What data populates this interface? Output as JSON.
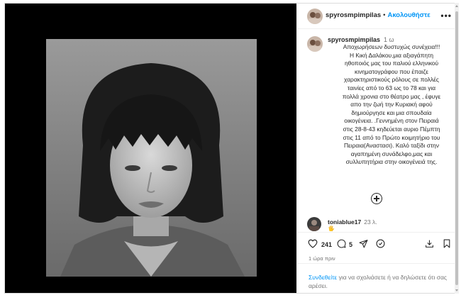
{
  "header": {
    "username": "spyrosmpimpilas",
    "separator": "•",
    "follow_label": "Ακολουθήστε",
    "more_icon": "more-horizontal-icon",
    "more_glyph": "•••"
  },
  "caption": {
    "username": "spyrosmpimpilas",
    "time": "1 ω",
    "text": "Αποχωρήσεων δυστυχώς συνέχεια!!!\nΗ Κική Δαλάκου,μια αξιαγάπητη\nηθοποιός μας του παλιού ελληνικού\nκινηματογράφου που έπαιζε\nχαρακτηριστικούς ρόλους σε πολλές\nταινίες από το 63 ως το 78 και για\nπολλά χρονια στο θέατρο μας , έφυγε\nαπο την ζωή την Κυριακή αφού\nδημιούργησε και μια σπουδαία\nοικογένεια. .Γεννημένη στον Πειραιά\nστις 28-8-43 κηδεύεται αυριο Πέμπτη\nστις 11 από το Πρώτο κοιμητήριο του\nΠειραια(Αναστασι). Καλό ταξίδι στην\nαγαπημένη συνάδελφο,μας και\nσυλλυπητήρια στην οικογένειά της."
  },
  "load_more_icon": "plus-circle-icon",
  "comment": {
    "username": "toniablue17",
    "time": "23 λ.",
    "cut_text": "🖐"
  },
  "actions": {
    "likes": "241",
    "comments": "5",
    "like_icon": "heart-icon",
    "comment_icon": "comment-icon",
    "share_icon": "send-icon",
    "remix_icon": "remix-icon",
    "download_icon": "download-icon",
    "save_icon": "bookmark-icon"
  },
  "timestamp": "1 ώρα πριν",
  "login_prompt": {
    "link": "Συνδεθείτε",
    "text": " για να σχολιάσετε ή να δηλώσετε ότι σας αρέσει."
  },
  "colors": {
    "accent": "#0095f6",
    "text": "#262626",
    "muted": "#737373",
    "media_bg": "#000000"
  }
}
